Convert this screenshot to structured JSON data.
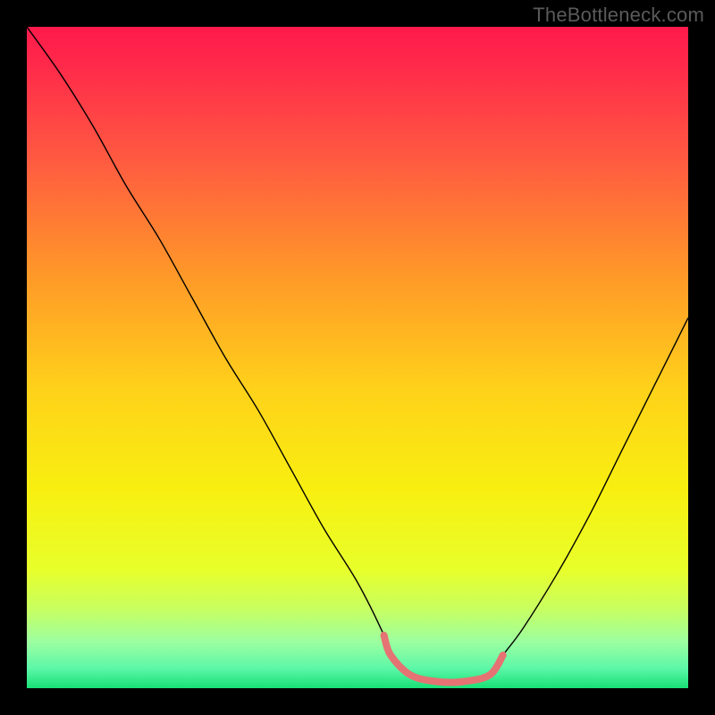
{
  "watermark": "TheBottleneck.com",
  "chart_data": {
    "type": "line",
    "title": "",
    "xlabel": "",
    "ylabel": "",
    "xlim": [
      0,
      100
    ],
    "ylim": [
      0,
      100
    ],
    "series": [
      {
        "name": "bottleneck-curve",
        "x": [
          0,
          5,
          10,
          15,
          20,
          25,
          30,
          35,
          40,
          45,
          50,
          54,
          55,
          58,
          62,
          66,
          70,
          72,
          75,
          80,
          85,
          90,
          95,
          100
        ],
        "y": [
          100,
          93,
          85,
          76,
          68,
          59,
          50,
          42,
          33,
          24,
          16,
          8,
          5,
          2,
          1,
          1,
          2,
          5,
          9,
          17,
          26,
          36,
          46,
          56
        ],
        "stroke": "#000000",
        "stroke_width": 1.4
      },
      {
        "name": "optimal-band-marker",
        "x": [
          54,
          55,
          58,
          62,
          66,
          70,
          72
        ],
        "y": [
          8,
          5,
          2,
          1,
          1,
          2,
          5
        ],
        "stroke": "#e57373",
        "stroke_width": 8
      }
    ],
    "background_gradient_stops": [
      {
        "offset": 0.0,
        "color": "#ff1a4b"
      },
      {
        "offset": 0.06,
        "color": "#ff2a4a"
      },
      {
        "offset": 0.2,
        "color": "#ff5a41"
      },
      {
        "offset": 0.38,
        "color": "#ff9a28"
      },
      {
        "offset": 0.55,
        "color": "#ffd21a"
      },
      {
        "offset": 0.7,
        "color": "#f8ef10"
      },
      {
        "offset": 0.82,
        "color": "#e8ff2a"
      },
      {
        "offset": 0.88,
        "color": "#c8ff60"
      },
      {
        "offset": 0.93,
        "color": "#9cffa0"
      },
      {
        "offset": 0.97,
        "color": "#5cf7a8"
      },
      {
        "offset": 1.0,
        "color": "#18e076"
      }
    ]
  }
}
